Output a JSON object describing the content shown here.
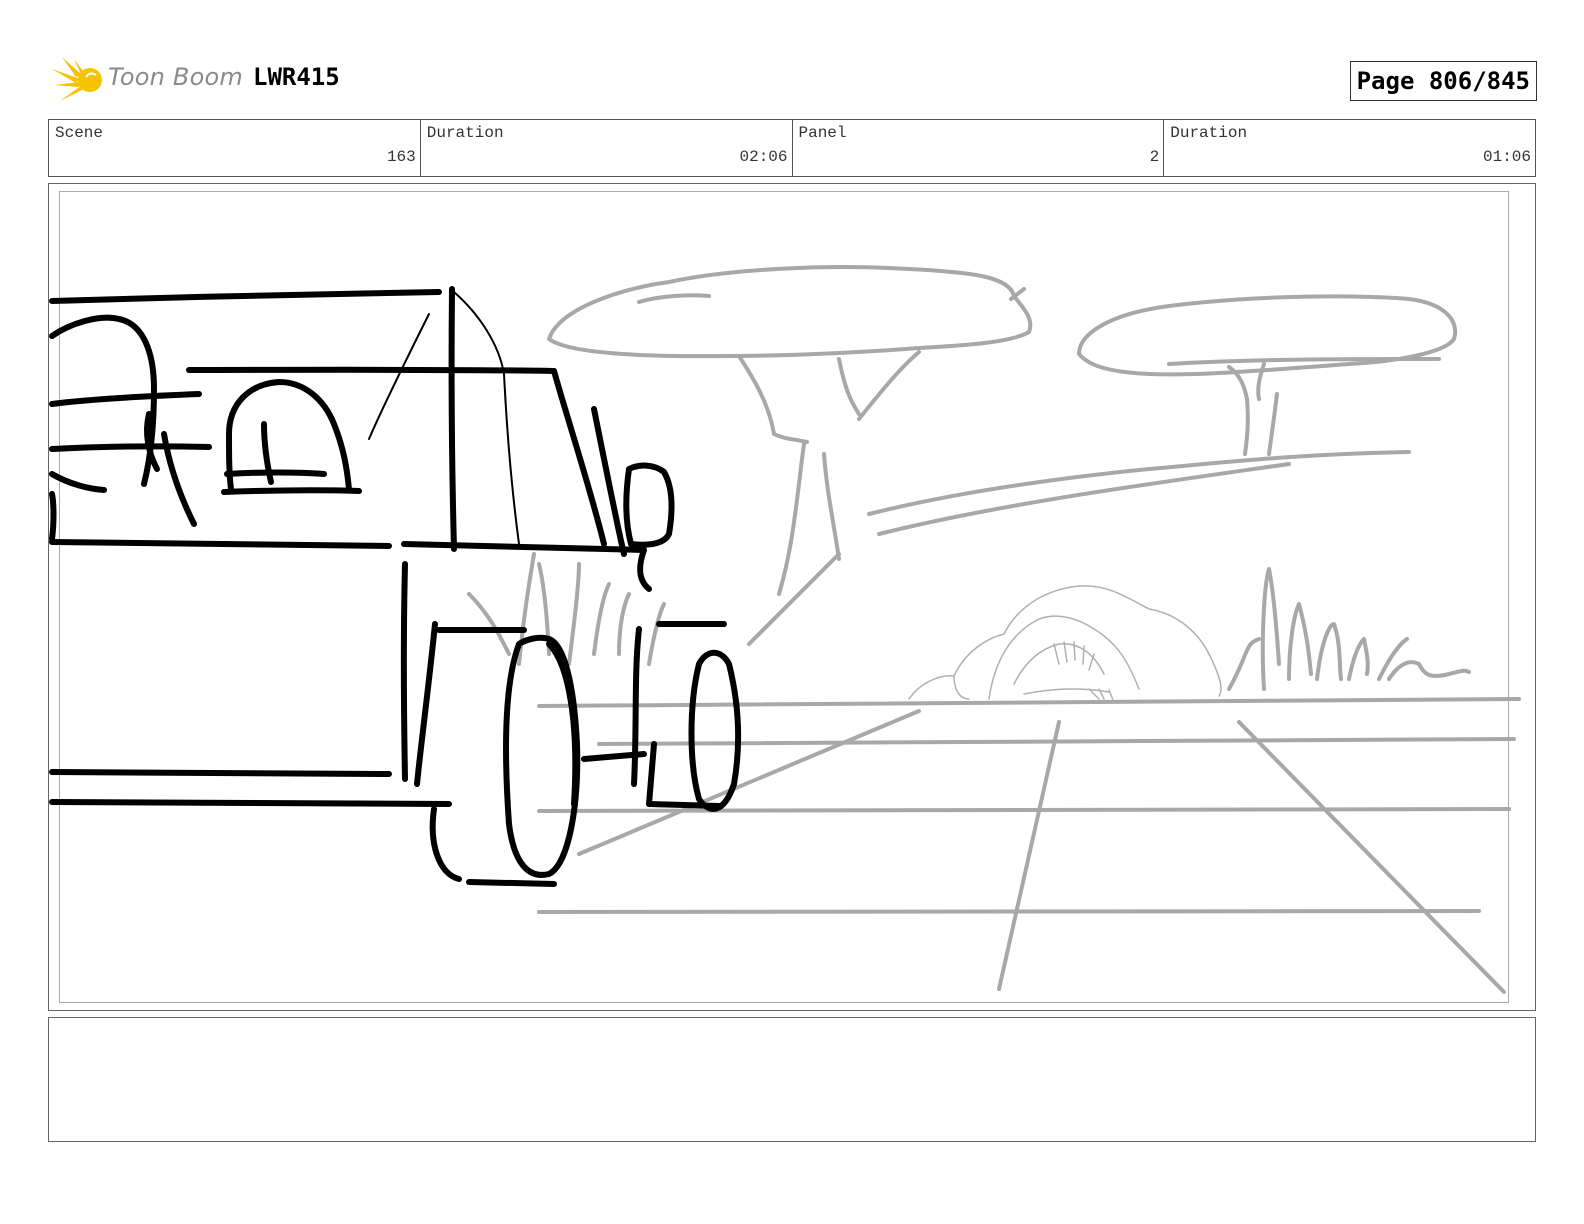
{
  "header": {
    "logo_text": "Toon Boom",
    "project": "LWR415",
    "page": "Page 806/845"
  },
  "info": {
    "scene_label": "Scene",
    "scene_value": "163",
    "scene_duration_label": "Duration",
    "scene_duration_value": "02:06",
    "panel_label": "Panel",
    "panel_value": "2",
    "panel_duration_label": "Duration",
    "panel_duration_value": "01:06"
  },
  "colors": {
    "logo_sun": "#f5c400",
    "sketch_dark": "#000000",
    "sketch_gray": "#a8a8a8",
    "border": "#555555"
  },
  "notes": {
    "text": ""
  }
}
